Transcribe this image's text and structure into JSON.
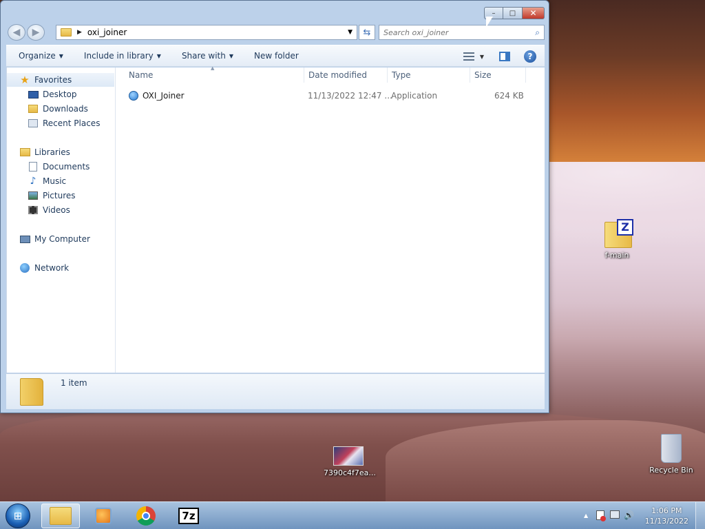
{
  "window": {
    "address": {
      "folder": "oxi_joiner"
    },
    "search_placeholder": "Search oxi_joiner",
    "caption": {
      "minimize": "–",
      "maximize": "□",
      "close": "✕"
    },
    "nav": {
      "back": "◀",
      "forward": "▶"
    }
  },
  "toolbar": {
    "organize": "Organize",
    "include_in_library": "Include in library",
    "share_with": "Share with",
    "new_folder": "New folder"
  },
  "navpane": {
    "favorites": {
      "label": "Favorites",
      "icon": "star-icon"
    },
    "favorites_items": [
      {
        "label": "Desktop",
        "icon": "desktop-icon"
      },
      {
        "label": "Downloads",
        "icon": "downloads-icon"
      },
      {
        "label": "Recent Places",
        "icon": "recent-places-icon"
      }
    ],
    "libraries": {
      "label": "Libraries",
      "icon": "libraries-icon"
    },
    "libraries_items": [
      {
        "label": "Documents",
        "icon": "documents-icon"
      },
      {
        "label": "Music",
        "icon": "music-icon"
      },
      {
        "label": "Pictures",
        "icon": "pictures-icon"
      },
      {
        "label": "Videos",
        "icon": "videos-icon"
      }
    ],
    "computer": {
      "label": "My Computer",
      "icon": "computer-icon"
    },
    "network": {
      "label": "Network",
      "icon": "network-icon"
    }
  },
  "columns": {
    "name": "Name",
    "date_modified": "Date modified",
    "type": "Type",
    "size": "Size"
  },
  "files": [
    {
      "name": "OXI_Joiner",
      "date_modified": "11/13/2022 12:47 ...",
      "type": "Application",
      "size": "624 KB"
    }
  ],
  "details": {
    "count": "1 item"
  },
  "desktop": {
    "icons": [
      {
        "label": "f-main",
        "icon": "zip-folder-icon"
      },
      {
        "label": "7390c4f7ea...",
        "icon": "image-file-icon"
      },
      {
        "label": "Recycle Bin",
        "icon": "recycle-bin-icon"
      }
    ],
    "zip_glyph": "Z"
  },
  "taskbar": {
    "start_glyph": "⊞",
    "items": [
      {
        "name": "explorer",
        "icon": "folder-icon"
      },
      {
        "name": "media-player",
        "icon": "media-player-icon"
      },
      {
        "name": "chrome",
        "icon": "chrome-icon"
      },
      {
        "name": "7zip",
        "icon": "7zip-icon",
        "label": "7z"
      }
    ],
    "clock": {
      "time": "1:06 PM",
      "date": "11/13/2022"
    },
    "tray": {
      "show_hidden": "▲",
      "volume": "🔊"
    }
  }
}
